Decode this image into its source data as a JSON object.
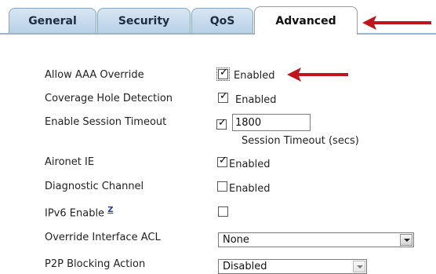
{
  "tabs": [
    "General",
    "Security",
    "QoS",
    "Advanced"
  ],
  "rows": {
    "allow_aaa_override": {
      "label": "Allow AAA Override",
      "checked": true,
      "status": "Enabled"
    },
    "coverage_hole_detection": {
      "label": "Coverage Hole Detection",
      "checked": true,
      "status": "Enabled"
    },
    "session_timeout": {
      "label": "Enable Session Timeout",
      "checked": true,
      "value": "1800",
      "unit": "Session Timeout (secs)"
    },
    "aironet_ie": {
      "label": "Aironet IE",
      "checked": true,
      "status": "Enabled"
    },
    "diagnostic_channel": {
      "label": "Diagnostic Channel",
      "checked": false,
      "status": "Enabled"
    },
    "ipv6_enable": {
      "label": "IPv6 Enable",
      "help": "Z",
      "checked": false
    },
    "override_interface_acl": {
      "label": "Override Interface ACL",
      "selected": "None"
    },
    "p2p_blocking_action": {
      "label": "P2P Blocking Action",
      "selected": "Disabled"
    }
  },
  "annotation_color": "#c0141e"
}
